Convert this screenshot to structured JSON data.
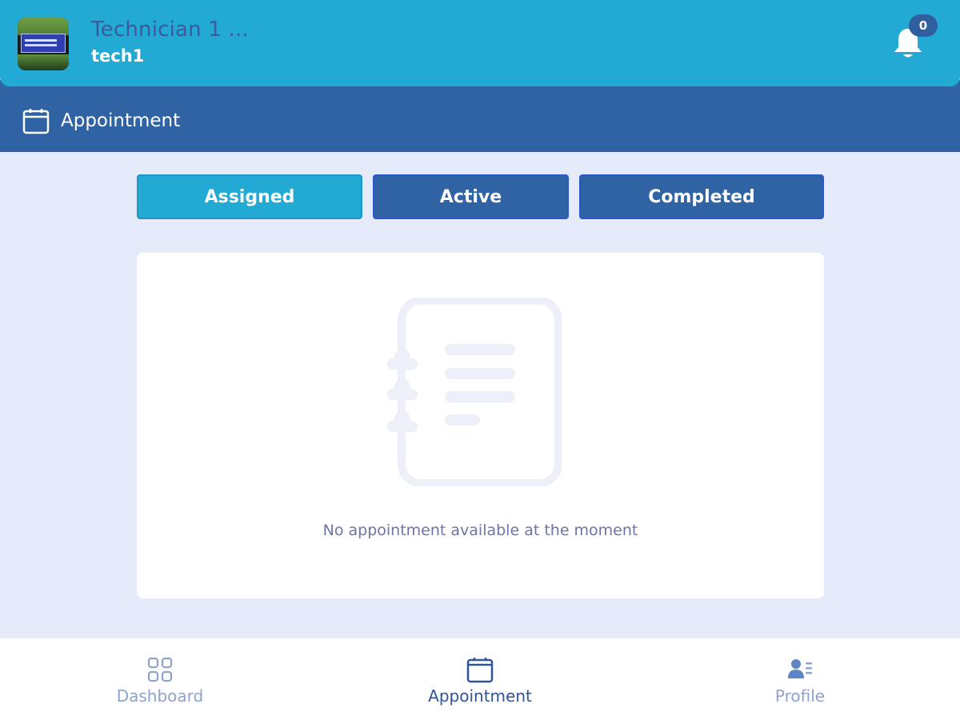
{
  "header": {
    "user_name": "Technician 1 ...",
    "user_id": "tech1",
    "notification_count": "0"
  },
  "section": {
    "title": "Appointment"
  },
  "tabs": [
    {
      "label": "Assigned",
      "selected": true
    },
    {
      "label": "Active",
      "selected": false
    },
    {
      "label": "Completed",
      "selected": false
    }
  ],
  "empty_state": {
    "message": "No appointment available at the moment"
  },
  "bottom_nav": {
    "items": [
      {
        "label": "Dashboard",
        "icon": "grid-icon",
        "active": false
      },
      {
        "label": "Appointment",
        "icon": "calendar-icon",
        "active": true
      },
      {
        "label": "Profile",
        "icon": "profile-card-icon",
        "active": false
      }
    ]
  },
  "colors": {
    "header_bg": "#22a9d4",
    "section_bg": "#2f63a3",
    "page_bg": "#e6ebfb",
    "tab_selected": "#22a9d4",
    "tab_default": "#2f63a3",
    "nav_active": "#2f5597",
    "nav_inactive": "#8fa3cc"
  }
}
